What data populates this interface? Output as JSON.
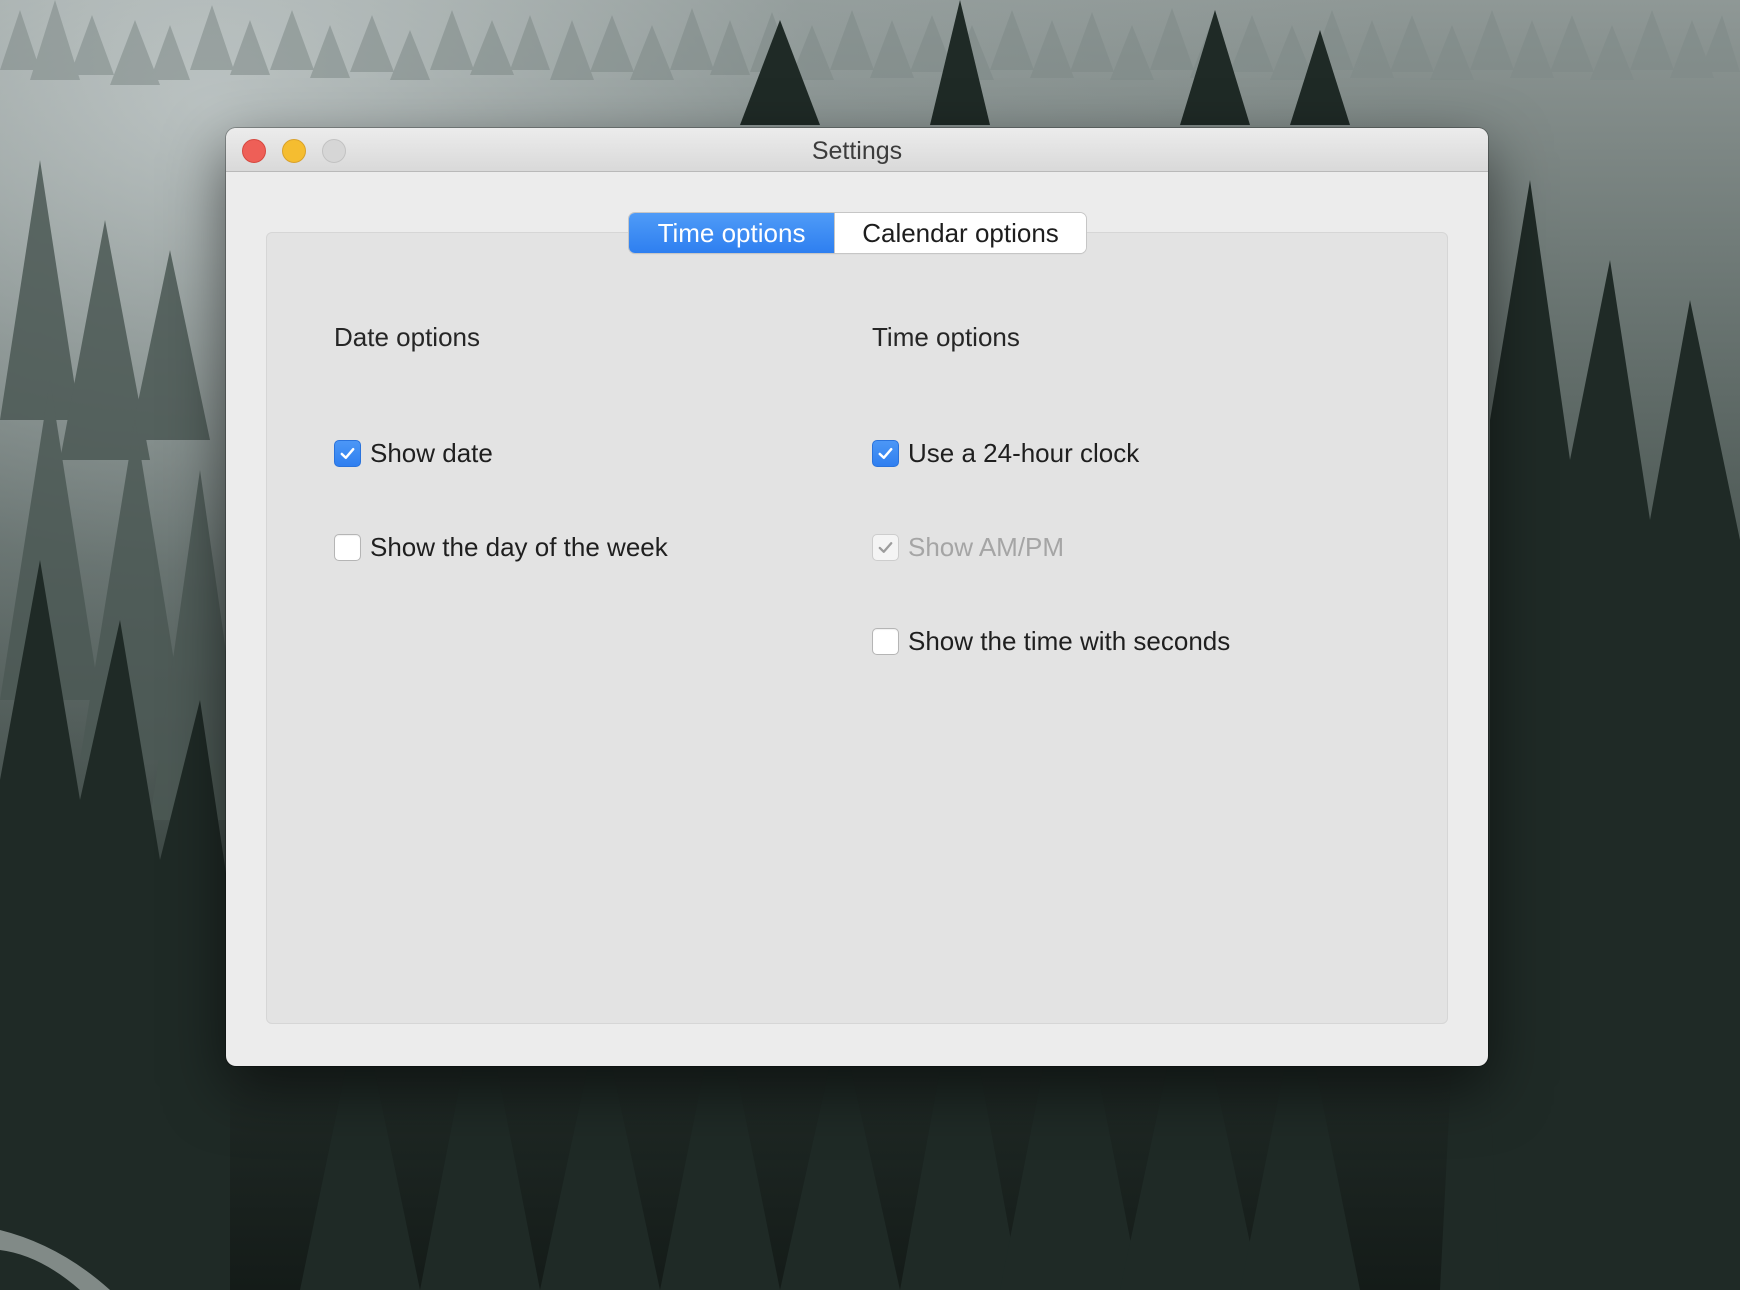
{
  "window": {
    "title": "Settings"
  },
  "tabs": [
    {
      "label": "Time options",
      "selected": true
    },
    {
      "label": "Calendar options",
      "selected": false
    }
  ],
  "date_group": {
    "heading": "Date options",
    "options": [
      {
        "label": "Show date",
        "checked": true,
        "enabled": true
      },
      {
        "label": "Show the day of the week",
        "checked": false,
        "enabled": true
      }
    ]
  },
  "time_group": {
    "heading": "Time options",
    "options": [
      {
        "label": "Use a 24-hour clock",
        "checked": true,
        "enabled": true
      },
      {
        "label": "Show AM/PM",
        "checked": true,
        "enabled": false
      },
      {
        "label": "Show the time with seconds",
        "checked": false,
        "enabled": true
      }
    ]
  },
  "colors": {
    "accent": "#2f7ff0",
    "close": "#ee5f57",
    "minimize": "#f5bd30",
    "zoom_inactive": "#d6d6d6"
  },
  "icons": {
    "checkmark": "checkmark-icon"
  }
}
